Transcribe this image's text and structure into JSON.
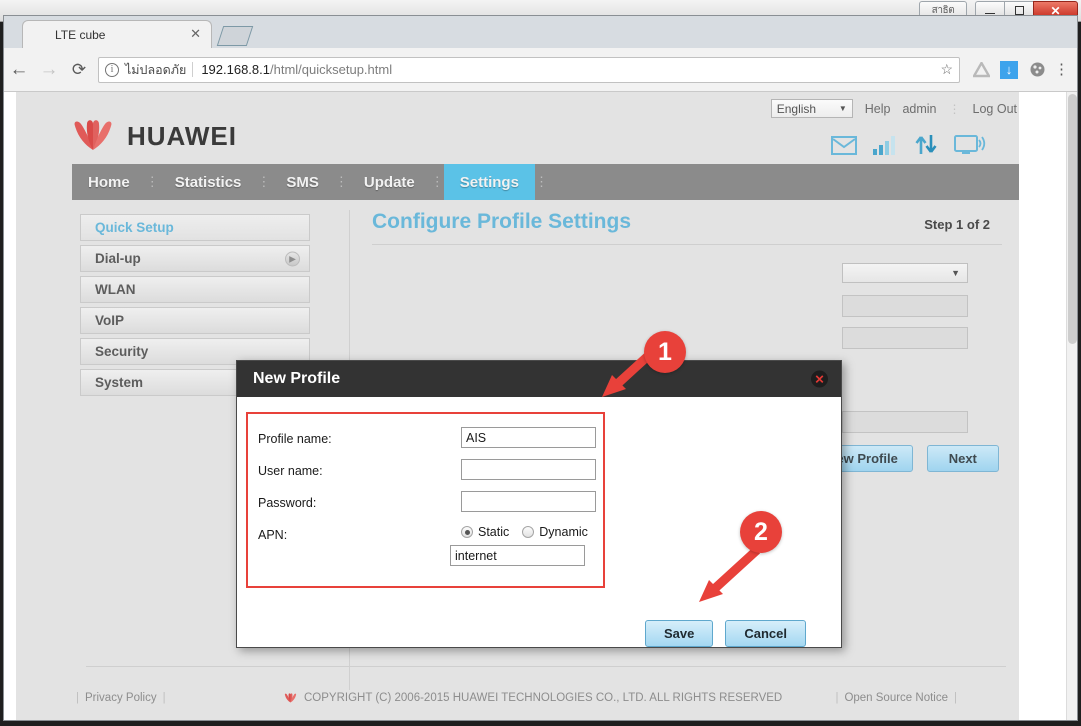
{
  "os_window": {
    "extra_button_label": "สาธิต",
    "minimize_label": "—",
    "maximize_label": "❐",
    "close_label": "✕"
  },
  "browser": {
    "tab_title": "LTE cube",
    "tab_close_label": "✕",
    "back_label": "←",
    "forward_label": "→",
    "reload_label": "⟳",
    "security_label": "ไม่ปลอดภัย",
    "url_host": "192.168.8.1",
    "url_path": "/html/quicksetup.html",
    "star_label": "☆",
    "menu_label": "⋮",
    "info_label": "i"
  },
  "header": {
    "language": "English",
    "language_caret": "▼",
    "help_label": "Help",
    "user_label": "admin",
    "separator": "⋮",
    "logout_label": "Log Out",
    "brand": "HUAWEI"
  },
  "status_icons": [
    {
      "name": "message-icon",
      "glyph": "✉"
    },
    {
      "name": "signal-icon",
      "glyph": "signal"
    },
    {
      "name": "data-transfer-icon",
      "glyph": "⇅"
    },
    {
      "name": "connected-device-icon",
      "glyph": "monitor"
    }
  ],
  "nav": {
    "items": [
      {
        "label": "Home",
        "active": false
      },
      {
        "label": "Statistics",
        "active": false
      },
      {
        "label": "SMS",
        "active": false
      },
      {
        "label": "Update",
        "active": false
      },
      {
        "label": "Settings",
        "active": true
      }
    ],
    "separator": "⋮"
  },
  "sidebar": {
    "items": [
      {
        "label": "Quick Setup",
        "active": true,
        "arrow": false
      },
      {
        "label": "Dial-up",
        "active": false,
        "arrow": true
      },
      {
        "label": "WLAN",
        "active": false,
        "arrow": false
      },
      {
        "label": "VoIP",
        "active": false,
        "arrow": false
      },
      {
        "label": "Security",
        "active": false,
        "arrow": false
      },
      {
        "label": "System",
        "active": false,
        "arrow": false
      }
    ],
    "arrow_glyph": "▶"
  },
  "main": {
    "title": "Configure Profile Settings",
    "step_label": "Step 1 of 2",
    "select_caret": "▼",
    "new_profile_button": "New Profile",
    "next_button": "Next"
  },
  "modal": {
    "title": "New Profile",
    "close_label": "✕",
    "fields": [
      {
        "label": "Profile name:",
        "value": "AIS"
      },
      {
        "label": "User name:",
        "value": ""
      },
      {
        "label": "Password:",
        "value": ""
      }
    ],
    "apn": {
      "label": "APN:",
      "options": [
        {
          "label": "Static",
          "selected": true
        },
        {
          "label": "Dynamic",
          "selected": false
        }
      ],
      "value": "internet"
    },
    "save_button": "Save",
    "cancel_button": "Cancel"
  },
  "annotations": [
    {
      "number": "1",
      "target": "modal-header"
    },
    {
      "number": "2",
      "target": "save-button"
    }
  ],
  "footer": {
    "privacy_policy": "Privacy Policy",
    "copyright": "COPYRIGHT (C) 2006-2015 HUAWEI TECHNOLOGIES CO., LTD. ALL RIGHTS RESERVED",
    "open_source_notice": "Open Source Notice",
    "pipe": "|"
  },
  "colors": {
    "accent_blue": "#5bc2e7",
    "annotation_red": "#e8413a",
    "nav_gray": "#8b8b8b",
    "modal_header": "#333333",
    "page_bg": "#e3e3e3"
  }
}
